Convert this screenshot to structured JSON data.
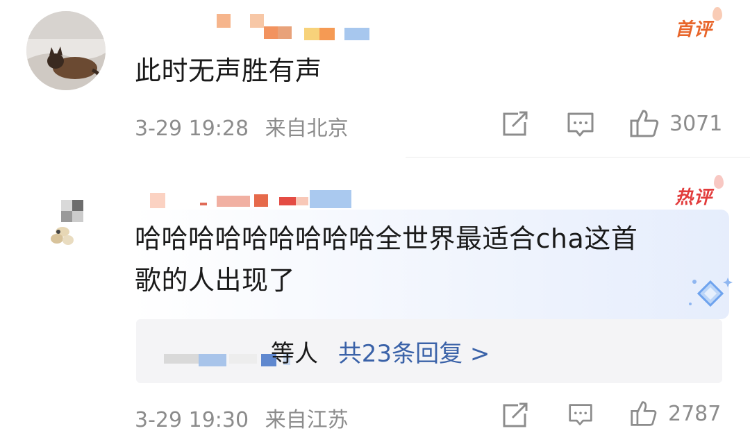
{
  "comments": [
    {
      "badge": "首评",
      "content": "此时无声胜有声",
      "date": "3-29 19:28",
      "location": "来自北京",
      "likes": "3071",
      "icons": {
        "share": "share-icon",
        "reply": "comment-icon",
        "like": "thumbs-up-icon"
      }
    },
    {
      "badge": "热评",
      "content_line1": "哈哈哈哈哈哈哈哈哈全世界最适合cha这首",
      "content_line2": "歌的人出现了",
      "date": "3-29 19:30",
      "location": "来自江苏",
      "likes": "2787",
      "reply_summary": {
        "names_suffix": "等人",
        "link": "共23条回复 >"
      },
      "icons": {
        "share": "share-icon",
        "reply": "comment-icon",
        "like": "thumbs-up-icon"
      }
    }
  ],
  "colors": {
    "badge_first": "#e8652a",
    "badge_hot": "#e23c3c",
    "link_blue": "#3a62a8",
    "meta_gray": "#8c8c8c"
  }
}
